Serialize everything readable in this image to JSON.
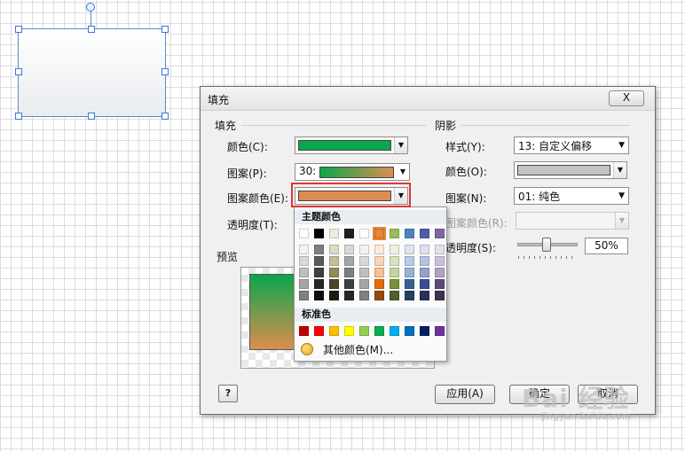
{
  "dialog": {
    "title": "填充",
    "close_label": "X",
    "fill_section": "填充",
    "shadow_section": "阴影",
    "fill": {
      "color_label": "颜色(C):",
      "pattern_label": "图案(P):",
      "pattern_value": "30:",
      "pattern_color_label": "图案颜色(E):",
      "transparency_label": "透明度(T):",
      "color_value": "#0aa64b",
      "pattern_color_value": "#de8d4f"
    },
    "shadow": {
      "style_label": "样式(Y):",
      "style_value": "13: 自定义偏移",
      "color_label": "颜色(O):",
      "pattern_label": "图案(N):",
      "pattern_value": "01: 纯色",
      "pattern_color_label": "图案颜色(R):",
      "transparency_label": "透明度(S):",
      "transparency_value": "50%",
      "color_value": "#c4c4c4"
    },
    "preview_label": "预览",
    "help_label": "?",
    "apply_label": "应用(A)",
    "ok_label": "确定",
    "cancel_label": "取消"
  },
  "palette": {
    "theme_heading": "主题颜色",
    "standard_heading": "标准色",
    "more_colors": "其他颜色(M)...",
    "theme_top": [
      "#ffffff",
      "#000000",
      "#eeece1",
      "#1f1f1f",
      "#ffffff",
      "#e8843a",
      "#9bbb59",
      "#4f81bd",
      "#4e5ea5",
      "#8064a2"
    ],
    "theme_columns": [
      [
        "#f2f2f2",
        "#d9d9d9",
        "#bfbfbf",
        "#a6a6a6",
        "#808080"
      ],
      [
        "#7f7f7f",
        "#595959",
        "#404040",
        "#262626",
        "#0d0d0d"
      ],
      [
        "#ddd9c3",
        "#c4bd97",
        "#948a54",
        "#4a452a",
        "#1e1c11"
      ],
      [
        "#d8d8d8",
        "#a6a6a6",
        "#7f7f7f",
        "#3f3f3f",
        "#262626"
      ],
      [
        "#f2f2f2",
        "#d9d9d9",
        "#bfbfbf",
        "#a6a6a6",
        "#808080"
      ],
      [
        "#fde9d9",
        "#fbd5b5",
        "#fac08f",
        "#e36c09",
        "#974806"
      ],
      [
        "#ebf1dd",
        "#d7e3bc",
        "#c3d69b",
        "#76923c",
        "#4f6128"
      ],
      [
        "#dbe5f1",
        "#b8cce4",
        "#95b3d7",
        "#366092",
        "#244061"
      ],
      [
        "#dde0f0",
        "#b9c0e0",
        "#95a0d1",
        "#3b4c93",
        "#272f61"
      ],
      [
        "#e5e0ec",
        "#ccc1d9",
        "#b2a2c7",
        "#5f497a",
        "#3f3151"
      ]
    ],
    "standard": [
      "#c00000",
      "#ff0000",
      "#ffc000",
      "#ffff00",
      "#92d050",
      "#00b050",
      "#00b0f0",
      "#0070c0",
      "#002060",
      "#7030a0"
    ]
  },
  "watermark": {
    "text": "Bai 经验",
    "sub": "jingyan.baidu.com"
  }
}
